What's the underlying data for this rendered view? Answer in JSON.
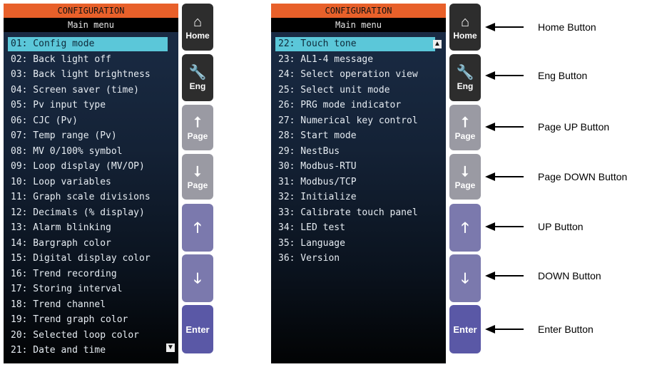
{
  "header": {
    "title": "CONFIGURATION",
    "subtitle": "Main menu"
  },
  "left_list": [
    "01: Config mode",
    "02: Back light off",
    "03: Back light brightness",
    "04: Screen saver (time)",
    "05: Pv input type",
    "06: CJC (Pv)",
    "07: Temp range (Pv)",
    "08: MV 0/100% symbol",
    "09: Loop display (MV/OP)",
    "10: Loop variables",
    "11: Graph scale divisions",
    "12: Decimals (% display)",
    "13: Alarm blinking",
    "14: Bargraph color",
    "15: Digital display color",
    "16: Trend recording",
    "17: Storing interval",
    "18: Trend channel",
    "19: Trend graph color",
    "20: Selected loop color",
    "21: Date and time"
  ],
  "right_list": [
    "22: Touch tone",
    "23: AL1-4 message",
    "24: Select operation view",
    "25: Select unit mode",
    "26: PRG mode indicator",
    "27: Numerical key control",
    "28: Start mode",
    "29: NestBus",
    "30: Modbus-RTU",
    "31: Modbus/TCP",
    "32: Initialize",
    "33: Calibrate touch panel",
    "34: LED test",
    "35: Language",
    "36: Version"
  ],
  "buttons": {
    "home": "Home",
    "eng": "Eng",
    "page_up": "Page",
    "page_down": "Page",
    "enter": "Enter"
  },
  "callouts": [
    "Home Button",
    "Eng Button",
    "Page UP Button",
    "Page DOWN Button",
    "UP Button",
    "DOWN Button",
    "Enter Button"
  ],
  "icons": {
    "home": "house-icon",
    "eng": "wrench-icon",
    "page_up": "page-up-arrow-icon",
    "page_down": "page-down-arrow-icon",
    "up": "up-arrow-icon",
    "down": "down-arrow-icon"
  },
  "colors": {
    "header": "#e8602a",
    "selection": "#5bc7d9",
    "button_dark": "#2d2d2d",
    "button_gray": "#9a9aa3",
    "button_lavender": "#7b79ad",
    "button_enter": "#5a58a6"
  }
}
